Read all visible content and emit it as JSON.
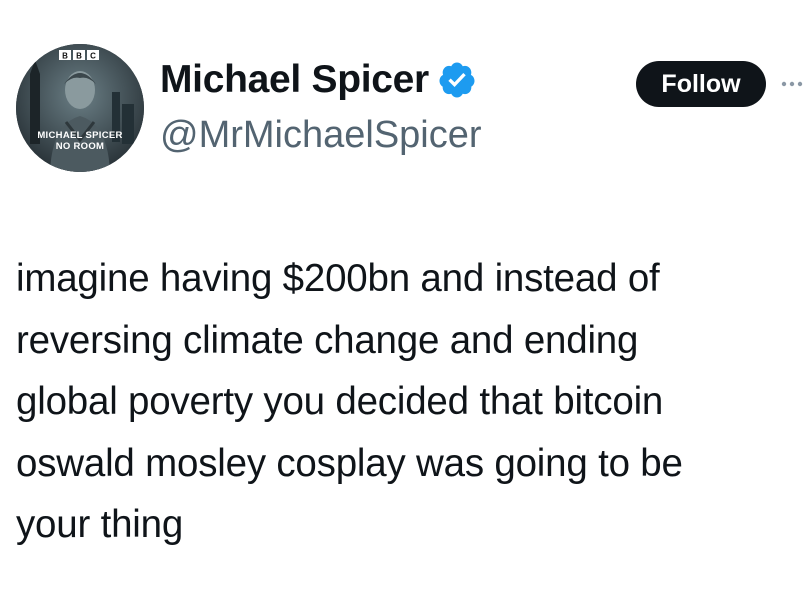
{
  "author": {
    "display_name": "Michael Spicer",
    "handle": "@MrMichaelSpicer",
    "verified": true,
    "avatar": {
      "badge_text": "BBC",
      "title_line1": "MICHAEL SPICER",
      "title_line2": "NO ROOM"
    }
  },
  "actions": {
    "follow_label": "Follow",
    "more_icon": "more-dots-icon"
  },
  "tweet": {
    "text": "imagine having $200bn and instead of\nreversing climate change and ending\nglobal poverty you decided that bitcoin\noswald mosley cosplay was going to be\nyour thing"
  },
  "colors": {
    "text": "#0f1419",
    "secondary_text": "#536471",
    "verified_badge": "#1d9bf0",
    "follow_button_bg": "#0f1419",
    "follow_button_text": "#ffffff"
  }
}
